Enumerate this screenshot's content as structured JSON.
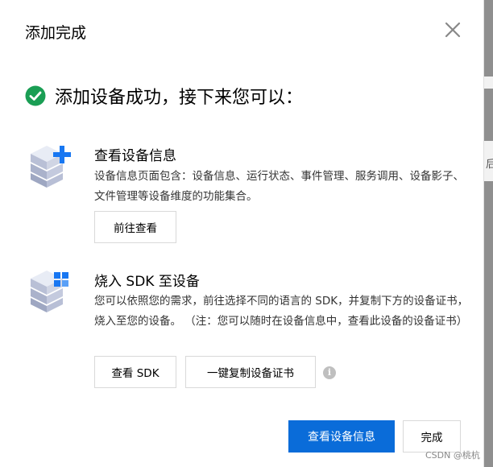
{
  "dialog": {
    "title": "添加完成",
    "success_message": "添加设备成功，接下来您可以："
  },
  "sections": [
    {
      "title": "查看设备信息",
      "description": "设备信息页面包含：设备信息、运行状态、事件管理、服务调用、设备影子、文件管理等设备维度的功能集合。",
      "button": "前往查看"
    },
    {
      "title": "烧入 SDK 至设备",
      "description": "您可以依照您的需求，前往选择不同的语言的 SDK，并复制下方的设备证书，烧入至您的设备。 （注：您可以随时在设备信息中，查看此设备的设备证书）",
      "buttons": [
        "查看 SDK",
        "一键复制设备证书"
      ]
    }
  ],
  "footer": {
    "primary_button": "查看设备信息",
    "secondary_button": "完成"
  },
  "background": {
    "right_char": "后"
  },
  "watermark": "CSDN @桃杭",
  "colors": {
    "primary": "#0a6cd9",
    "success": "#1a9e54",
    "icon_blue": "#1877f2"
  },
  "icons": {
    "close": "close-icon",
    "success": "check-circle-icon",
    "device_add": "server-plus-icon",
    "device_sdk": "server-grid-icon",
    "info": "info-icon"
  }
}
